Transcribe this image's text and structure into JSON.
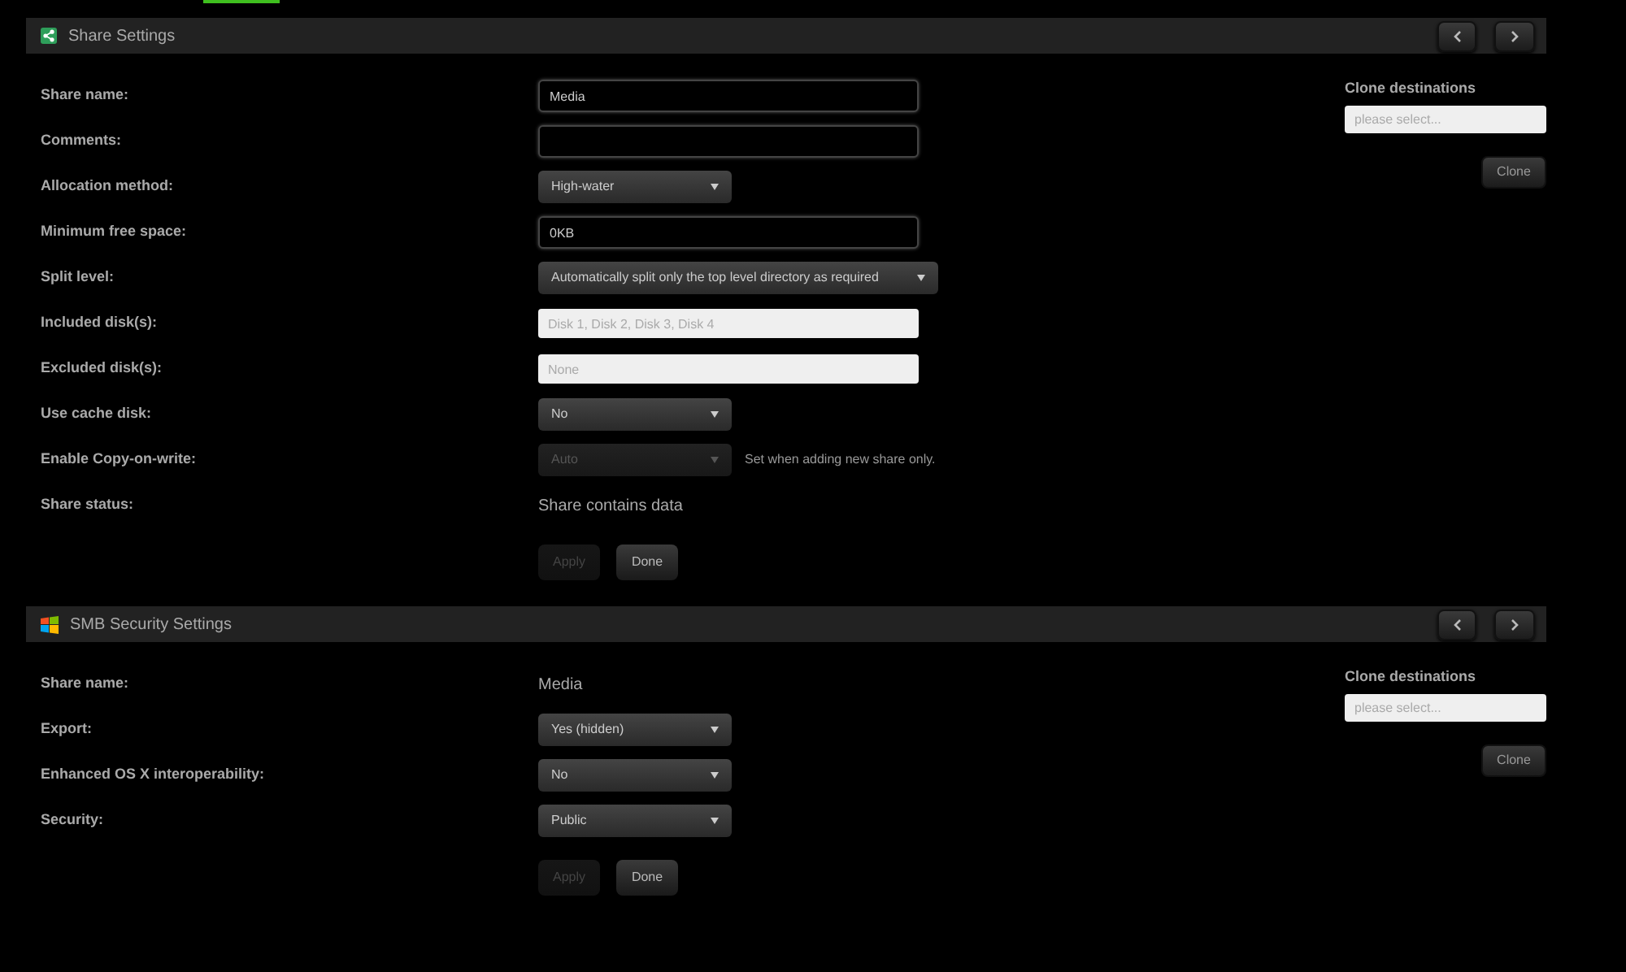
{
  "panels": [
    {
      "title": "Share Settings",
      "rows": [
        {
          "label": "Share name:",
          "kind": "text",
          "value": "Media"
        },
        {
          "label": "Comments:",
          "kind": "text",
          "value": ""
        },
        {
          "label": "Allocation method:",
          "kind": "select",
          "value": "High-water",
          "disabled": false
        },
        {
          "label": "Minimum free space:",
          "kind": "text",
          "value": "0KB"
        },
        {
          "label": "Split level:",
          "kind": "select",
          "value": "Automatically split only the top level directory as required",
          "disabled": false
        },
        {
          "label": "Included disk(s):",
          "kind": "picker",
          "placeholder": "Disk 1, Disk 2, Disk 3, Disk 4"
        },
        {
          "label": "Excluded disk(s):",
          "kind": "picker",
          "placeholder": "None"
        },
        {
          "label": "Use cache disk:",
          "kind": "select",
          "value": "No",
          "disabled": false
        },
        {
          "label": "Enable Copy-on-write:",
          "kind": "select",
          "value": "Auto",
          "disabled": true,
          "note": "Set when adding new share only."
        },
        {
          "label": "Share status:",
          "kind": "static",
          "value": "Share contains data"
        }
      ],
      "buttons": [
        {
          "label": "Apply",
          "disabled": true
        },
        {
          "label": "Done",
          "disabled": false
        }
      ],
      "clone": {
        "label": "Clone destinations",
        "placeholder": "please select...",
        "button": "Clone"
      }
    },
    {
      "title": "SMB Security Settings",
      "rows": [
        {
          "label": "Share name:",
          "kind": "static",
          "value": "Media"
        },
        {
          "label": "Export:",
          "kind": "select",
          "value": "Yes (hidden)",
          "disabled": false
        },
        {
          "label": "Enhanced OS X interoperability:",
          "kind": "select",
          "value": "No",
          "disabled": false
        },
        {
          "label": "Security:",
          "kind": "select",
          "value": "Public",
          "disabled": false
        }
      ],
      "buttons": [
        {
          "label": "Apply",
          "disabled": true
        },
        {
          "label": "Done",
          "disabled": false
        }
      ],
      "clone": {
        "label": "Clone destinations",
        "placeholder": "please select...",
        "button": "Clone"
      }
    }
  ]
}
